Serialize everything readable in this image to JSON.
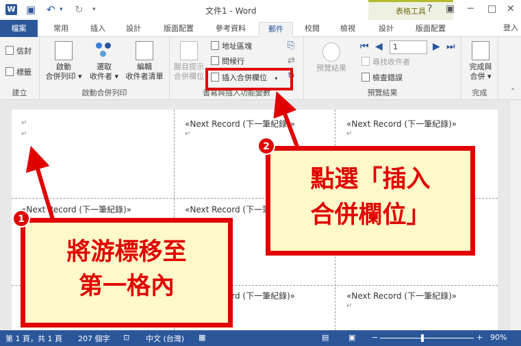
{
  "titlebar": {
    "app_icon": "W",
    "title": "文件1 - Word",
    "contextual_group": "表格工具",
    "help": "?",
    "restore": "▣",
    "minimize": "─",
    "maximize": "□",
    "close": "✕"
  },
  "tabs": {
    "file": "檔案",
    "home": "常用",
    "insert": "插入",
    "design": "設計",
    "layout": "版面配置",
    "references": "參考資料",
    "mailings": "郵件",
    "review": "校閱",
    "view": "檢視",
    "table_design": "設計",
    "table_layout": "版面配置",
    "login": "登入"
  },
  "ribbon": {
    "group_create": {
      "label": "建立",
      "envelopes": "信封",
      "labels": "標籤"
    },
    "group_start": {
      "label": "啟動合併列印",
      "start_merge": [
        "啟動",
        "合併列印"
      ],
      "select_recipients": [
        "選取",
        "收件者"
      ],
      "edit_list": [
        "編輯",
        "收件者清單"
      ]
    },
    "group_fields": {
      "label": "書寫與插入功能變數",
      "highlight_fields": [
        "醒目提示",
        "合併欄位"
      ],
      "address_block": "地址區塊",
      "greeting_line": "問候行",
      "insert_merge_field": "插入合併欄位"
    },
    "group_preview": {
      "label": "預覽結果",
      "preview_results": "預覽結果",
      "record_number": "1",
      "find_recipient": "尋找收件者",
      "check_errors": "檢查錯誤"
    },
    "group_finish": {
      "label": "完成",
      "finish_merge": [
        "完成與",
        "合併"
      ]
    }
  },
  "document": {
    "next_record": "«Next Record (下一筆紀錄)»",
    "para_mark": "↵"
  },
  "statusbar": {
    "page": "第 1 頁，共 1 頁",
    "words": "207 個字",
    "language": "中文 (台灣)",
    "zoom": "90%",
    "zoom_minus": "−",
    "zoom_plus": "+"
  },
  "annotations": {
    "callout1_line1": "將游標移至",
    "callout1_line2": "第一格內",
    "callout2_line1": "點選「插入",
    "callout2_line2": "合併欄位」",
    "badge1": "1",
    "badge2": "2"
  },
  "colors": {
    "word_blue": "#2b579a",
    "annotation_red": "#e00000",
    "callout_fill": "#fff8c8",
    "contextual_accent": "#b4b92e"
  }
}
